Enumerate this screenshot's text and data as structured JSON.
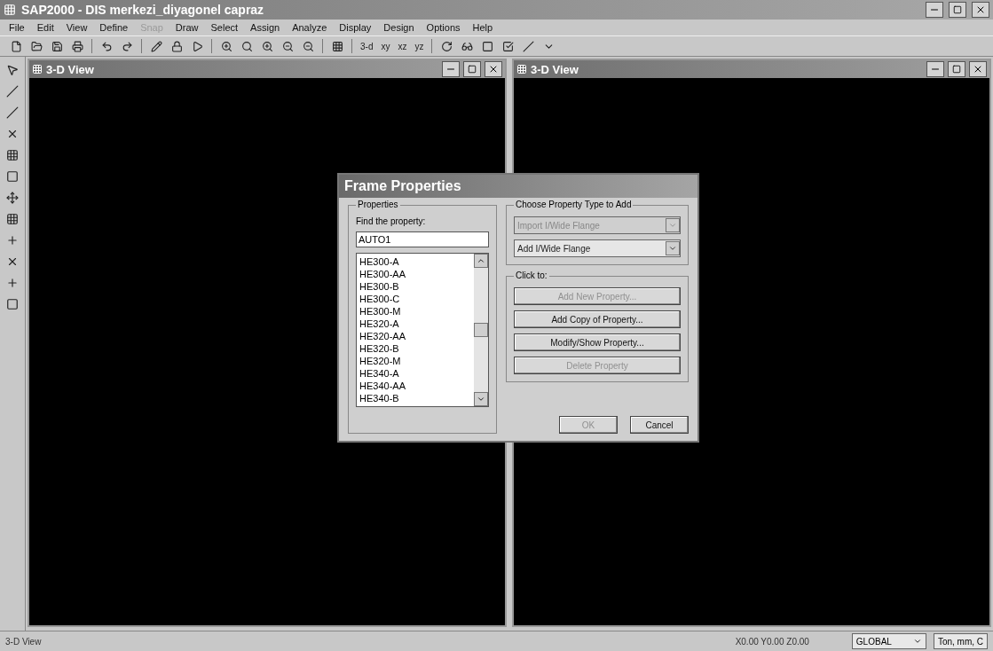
{
  "window": {
    "title": "SAP2000 - DIS merkezi_diyagonel capraz"
  },
  "menu": [
    {
      "label": "File",
      "disabled": false
    },
    {
      "label": "Edit",
      "disabled": false
    },
    {
      "label": "View",
      "disabled": false
    },
    {
      "label": "Define",
      "disabled": false
    },
    {
      "label": "Snap",
      "disabled": true
    },
    {
      "label": "Draw",
      "disabled": false
    },
    {
      "label": "Select",
      "disabled": false
    },
    {
      "label": "Assign",
      "disabled": false
    },
    {
      "label": "Analyze",
      "disabled": false
    },
    {
      "label": "Display",
      "disabled": false
    },
    {
      "label": "Design",
      "disabled": false
    },
    {
      "label": "Options",
      "disabled": false
    },
    {
      "label": "Help",
      "disabled": false
    }
  ],
  "toolbar": {
    "view_buttons": [
      "3-d",
      "xy",
      "xz",
      "yz"
    ]
  },
  "views": [
    {
      "title": "3-D View"
    },
    {
      "title": "3-D View"
    }
  ],
  "dialog": {
    "title": "Frame Properties",
    "properties_group": {
      "label": "Properties",
      "find_label": "Find the property:",
      "value": "AUTO1",
      "items": [
        "HE300-A",
        "HE300-AA",
        "HE300-B",
        "HE300-C",
        "HE300-M",
        "HE320-A",
        "HE320-AA",
        "HE320-B",
        "HE320-M",
        "HE340-A",
        "HE340-AA",
        "HE340-B"
      ]
    },
    "type_group": {
      "label": "Choose Property Type to Add",
      "dropdowns": [
        {
          "value": "Import I/Wide Flange",
          "disabled": true
        },
        {
          "value": "Add I/Wide Flange",
          "disabled": false
        }
      ]
    },
    "click_group": {
      "label": "Click to:",
      "buttons": [
        {
          "label": "Add New Property...",
          "disabled": true
        },
        {
          "label": "Add Copy of Property...",
          "disabled": false
        },
        {
          "label": "Modify/Show Property...",
          "disabled": false
        },
        {
          "label": "Delete Property",
          "disabled": true
        }
      ]
    },
    "buttons": [
      {
        "label": "OK",
        "disabled": true
      },
      {
        "label": "Cancel",
        "disabled": false
      }
    ]
  },
  "status_bar": {
    "view": "3-D View",
    "coordinates": "X0.00 Y0.00 Z0.00",
    "coordinate_system": "GLOBAL",
    "units": "Ton, mm, C"
  }
}
